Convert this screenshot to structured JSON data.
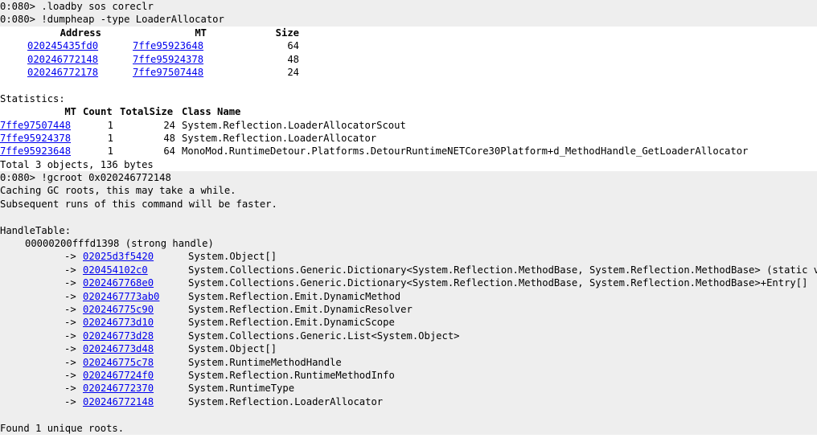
{
  "cmd1": {
    "prompt": "0:080> ",
    "command": ".loadby sos coreclr"
  },
  "cmd2": {
    "prompt": "0:080> ",
    "command": "!dumpheap -type LoaderAllocator",
    "headers": {
      "address": "Address",
      "mt": "MT",
      "size": "Size"
    },
    "rows": [
      {
        "address": "020245435fd0",
        "mt": "7ffe95923648",
        "size": "64"
      },
      {
        "address": "020246772148",
        "mt": "7ffe95924378",
        "size": "48"
      },
      {
        "address": "020246772178",
        "mt": "7ffe97507448",
        "size": "24"
      }
    ],
    "statistics_label": "Statistics:",
    "stats_headers": {
      "mt": "MT",
      "count": "Count",
      "total_size": "TotalSize",
      "class_name": "Class Name"
    },
    "stats_rows": [
      {
        "mt": "7ffe97507448",
        "count": "1",
        "total_size": "24",
        "class_name": "System.Reflection.LoaderAllocatorScout"
      },
      {
        "mt": "7ffe95924378",
        "count": "1",
        "total_size": "48",
        "class_name": "System.Reflection.LoaderAllocator"
      },
      {
        "mt": "7ffe95923648",
        "count": "1",
        "total_size": "64",
        "class_name": "MonoMod.RuntimeDetour.Platforms.DetourRuntimeNETCore30Platform+d_MethodHandle_GetLoaderAllocator"
      }
    ],
    "total": "Total 3 objects, 136 bytes"
  },
  "cmd3": {
    "prompt": "0:080> ",
    "command": "!gcroot 0x020246772148",
    "msg1": "Caching GC roots, this may take a while.",
    "msg2": "Subsequent runs of this command will be faster.",
    "handle_table_label": "HandleTable:",
    "handle": "00000200fffd1398 (strong handle)",
    "arrow": "->",
    "chain": [
      {
        "addr": "02025d3f5420",
        "type": "System.Object[]"
      },
      {
        "addr": "020454102c0",
        "type": "System.Collections.Generic.Dictionary<System.Reflection.MethodBase, System.Reflection.MethodBase> (static variable: System.Collections.Generic.Dictionary<System.Reflection.MethodBase, System.Reflection.MethodBase>)"
      },
      {
        "addr": "0202467768e0",
        "type": "System.Collections.Generic.Dictionary<System.Reflection.MethodBase, System.Reflection.MethodBase>+Entry[]"
      },
      {
        "addr": "0202467773ab0",
        "type": "System.Reflection.Emit.DynamicMethod"
      },
      {
        "addr": "020246775c90",
        "type": "System.Reflection.Emit.DynamicResolver"
      },
      {
        "addr": "020246773d10",
        "type": "System.Reflection.Emit.DynamicScope"
      },
      {
        "addr": "020246773d28",
        "type": "System.Collections.Generic.List<System.Object>"
      },
      {
        "addr": "020246773d48",
        "type": "System.Object[]"
      },
      {
        "addr": "020246775c78",
        "type": "System.RuntimeMethodHandle"
      },
      {
        "addr": "0202467724f0",
        "type": "System.Reflection.RuntimeMethodInfo"
      },
      {
        "addr": "020246772370",
        "type": "System.RuntimeType"
      },
      {
        "addr": "020246772148",
        "type": "System.Reflection.LoaderAllocator"
      }
    ],
    "found": "Found 1 unique roots."
  }
}
